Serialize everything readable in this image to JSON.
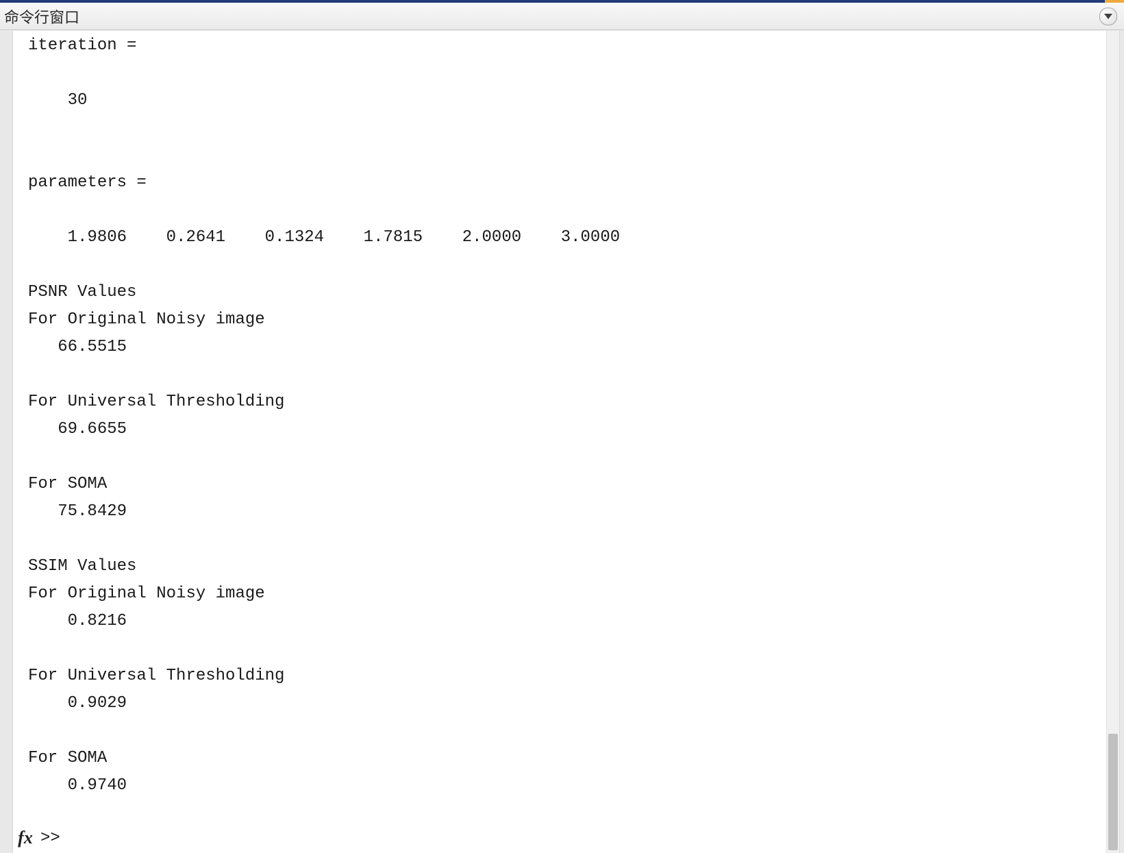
{
  "window": {
    "title": "命令行窗口"
  },
  "console": {
    "iteration_label": "iteration =",
    "iteration_value": "    30",
    "parameters_label": "parameters =",
    "parameters_row": "    1.9806    0.2641    0.1324    1.7815    2.0000    3.0000",
    "psnr_header": "PSNR Values",
    "psnr_orig_label": "For Original Noisy image",
    "psnr_orig_value": "   66.5515",
    "psnr_ut_label": "For Universal Thresholding",
    "psnr_ut_value": "   69.6655",
    "psnr_soma_label": "For SOMA",
    "psnr_soma_value": "   75.8429",
    "ssim_header": "SSIM Values",
    "ssim_orig_label": "For Original Noisy image",
    "ssim_orig_value": "    0.8216",
    "ssim_ut_label": "For Universal Thresholding",
    "ssim_ut_value": "    0.9029",
    "ssim_soma_label": "For SOMA",
    "ssim_soma_value": "    0.9740",
    "prompt": ">>"
  }
}
